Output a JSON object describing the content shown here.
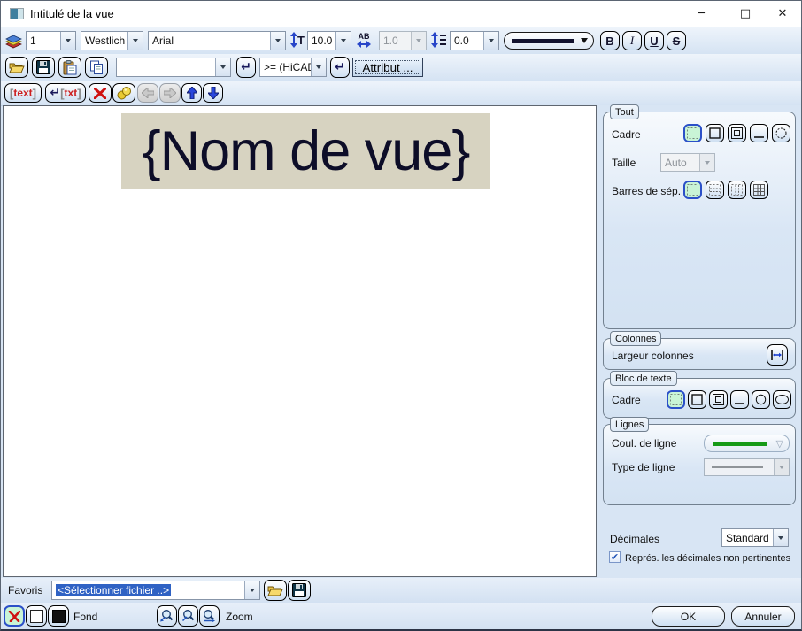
{
  "window": {
    "title": "Intitulé de la vue"
  },
  "icons": {
    "minimize": "─",
    "maximize": "□",
    "close": "✕",
    "enter": "↵",
    "check": "✔",
    "t": "T",
    "ab": "AB"
  },
  "format_bar": {
    "layer": "1",
    "alignment": "Westlich",
    "font": "Arial",
    "font_size": "10.0",
    "char_width": "1.0",
    "line_spacing": "0.0",
    "bold": "B",
    "italic": "I",
    "underline": "U",
    "strikethrough": "S"
  },
  "edit_bar": {
    "attribute_value": "",
    "attr_source": ">= (HiCAD",
    "attribute_button": "Attribut ...",
    "text_marker": "text",
    "txt_marker": "txt"
  },
  "canvas": {
    "placeholder_text": "{Nom de vue}"
  },
  "panel": {
    "tout": {
      "title": "Tout",
      "cadre": "Cadre",
      "taille": "Taille",
      "taille_value": "Auto",
      "barres": "Barres de sép."
    },
    "colonnes": {
      "title": "Colonnes",
      "largeur": "Largeur colonnes"
    },
    "bloc": {
      "title": "Bloc de texte",
      "cadre": "Cadre"
    },
    "lignes": {
      "title": "Lignes",
      "couleur": "Coul. de ligne",
      "type": "Type de ligne"
    },
    "decimales": {
      "label": "Décimales",
      "value": "Standard"
    },
    "options": {
      "non_pertinentes": "Représ. les décimales non pertinentes",
      "checked": true
    }
  },
  "favorites": {
    "label": "Favoris",
    "selected": "<Sélectionner fichier ..>"
  },
  "footer": {
    "fond": "Fond",
    "zoom": "Zoom",
    "ok": "OK",
    "cancel": "Annuler"
  },
  "colors": {
    "accent_blue": "#2b50c8",
    "selected_green": "#c9f4d6",
    "text_block_bg": "#d7d3c1",
    "text_navy": "#0d0d28",
    "line_green": "#169a16",
    "line_navy": "#12122e"
  }
}
